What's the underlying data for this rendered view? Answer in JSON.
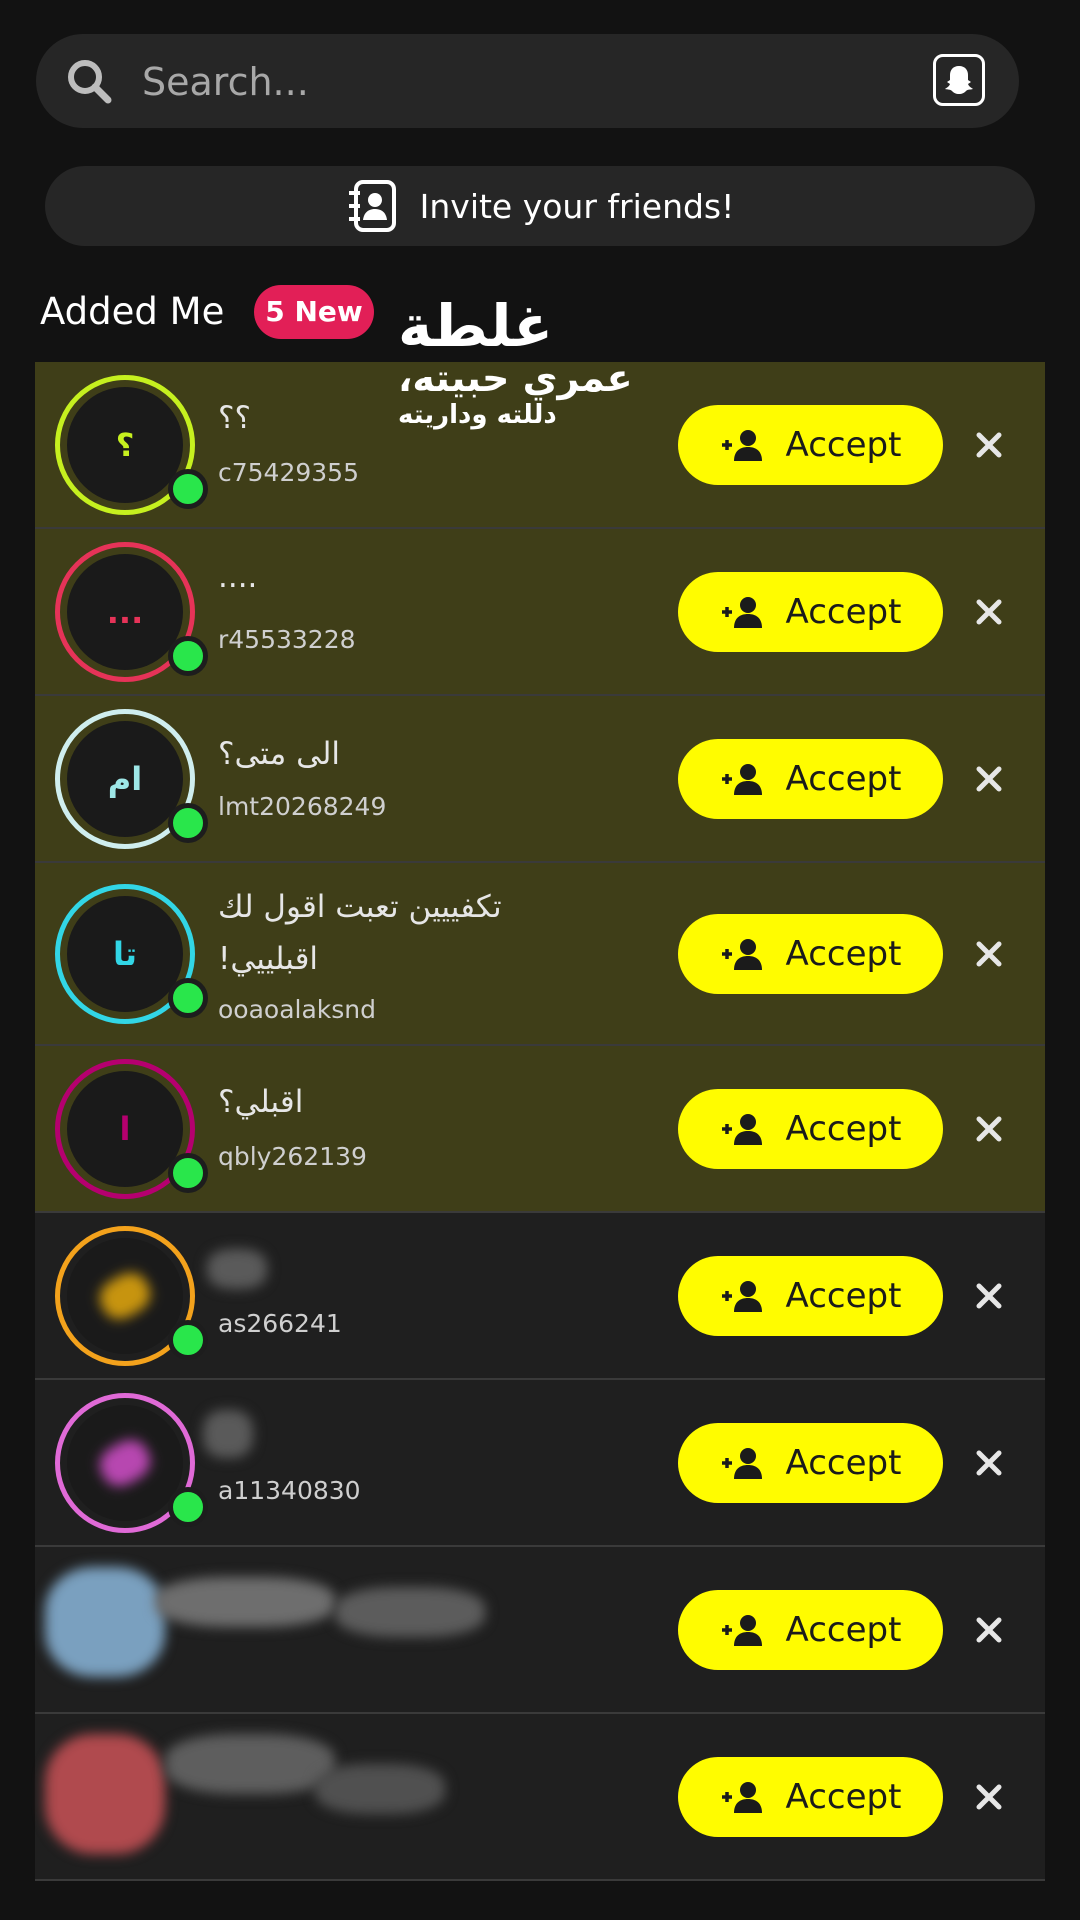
{
  "search": {
    "placeholder": "Search..."
  },
  "invite": {
    "label": "Invite your friends!"
  },
  "section": {
    "title": "Added Me",
    "badge": "5 New"
  },
  "overlay": {
    "line1": "غلطة",
    "line2": "عمري حبيته،",
    "line3": "دللته وداريته"
  },
  "accept_label": "Accept",
  "requests": [
    {
      "display_name": "؟؟",
      "username": "c75429355",
      "initial": "؟",
      "ring": "#c6f01f",
      "initial_color": "#c6f01f"
    },
    {
      "display_name": "....",
      "username": "r45533228",
      "initial": "...",
      "ring": "#e63358",
      "initial_color": "#e63358"
    },
    {
      "display_name": "الى متى؟",
      "username": "lmt20268249",
      "initial": "ام",
      "ring": "#cfeeee",
      "initial_color": "#9ee7e7"
    },
    {
      "display_name": "تكفييين تعبت اقول لك اقبلييي!",
      "username": "ooaoalaksnd",
      "initial": "تا",
      "ring": "#32d6e6",
      "initial_color": "#32d6e6"
    },
    {
      "display_name": "اقبلي؟",
      "username": "qbly262139",
      "initial": "ا",
      "ring": "#b5006f",
      "initial_color": "#b5006f"
    },
    {
      "display_name": "",
      "username": "as266241",
      "initial": "",
      "ring": "#f3a21c",
      "initial_color": "#f3a21c"
    },
    {
      "display_name": "",
      "username": "a11340830",
      "initial": "",
      "ring": "#e06ad7",
      "initial_color": "#e06ad7"
    },
    {
      "display_name": "",
      "username": "",
      "initial": "",
      "ring": "",
      "initial_color": ""
    },
    {
      "display_name": "",
      "username": "",
      "initial": "",
      "ring": "",
      "initial_color": ""
    }
  ],
  "colors": {
    "accent_yellow": "#fffc00",
    "badge_red": "#e21f57",
    "new_row_bg": "#3f3e18",
    "online_green": "#29e64b"
  }
}
